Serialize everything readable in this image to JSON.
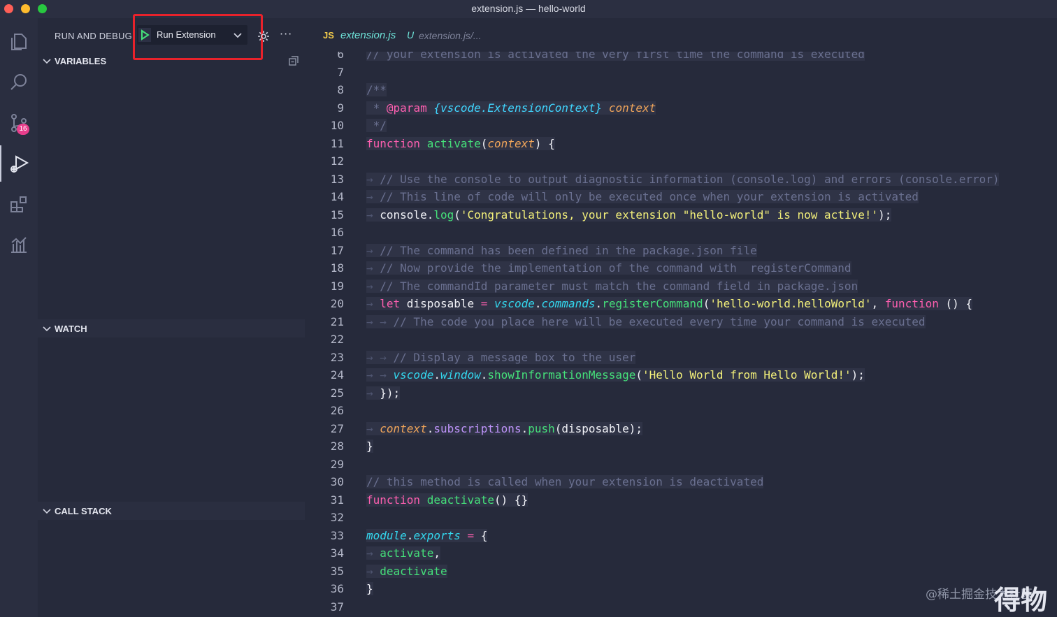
{
  "window": {
    "title": "extension.js — hello-world"
  },
  "activity_bar": {
    "scm_badge": "16"
  },
  "sidebar": {
    "title": "RUN AND DEBUG",
    "run_config": "Run Extension",
    "sections": {
      "variables": "VARIABLES",
      "watch": "WATCH",
      "call_stack": "CALL STACK"
    }
  },
  "editor": {
    "tab": {
      "badge": "JS",
      "filename": "extension.js",
      "status": "U",
      "path": "extension.js/..."
    },
    "lines": [
      {
        "n": "6",
        "tokens": [
          [
            "cm",
            "// your extension is activated the very first time the command is executed"
          ]
        ]
      },
      {
        "n": "7",
        "tokens": []
      },
      {
        "n": "8",
        "tokens": [
          [
            "cm",
            "/**"
          ]
        ]
      },
      {
        "n": "9",
        "tokens": [
          [
            "cm",
            " * "
          ],
          [
            "tg",
            "@param"
          ],
          [
            "tx",
            " "
          ],
          [
            "ty",
            "{vscode.ExtensionContext}"
          ],
          [
            "tx",
            " "
          ],
          [
            "pa",
            "context"
          ]
        ]
      },
      {
        "n": "10",
        "tokens": [
          [
            "cm",
            " */"
          ]
        ]
      },
      {
        "n": "11",
        "tokens": [
          [
            "kw",
            "function"
          ],
          [
            "tx",
            " "
          ],
          [
            "fn",
            "activate"
          ],
          [
            "tx",
            "("
          ],
          [
            "pa",
            "context"
          ],
          [
            "tx",
            ") {"
          ]
        ]
      },
      {
        "n": "12",
        "tokens": []
      },
      {
        "n": "13",
        "tokens": [
          [
            "dim",
            "→ "
          ],
          [
            "cm",
            "// Use the console to output diagnostic information (console.log) and errors (console.error)"
          ]
        ]
      },
      {
        "n": "14",
        "tokens": [
          [
            "dim",
            "→ "
          ],
          [
            "cm",
            "// This line of code will only be executed once when your extension is activated"
          ]
        ]
      },
      {
        "n": "15",
        "tokens": [
          [
            "dim",
            "→ "
          ],
          [
            "tx",
            "console."
          ],
          [
            "fn",
            "log"
          ],
          [
            "tx",
            "("
          ],
          [
            "st",
            "'Congratulations, your extension \"hello-world\" is now active!'"
          ],
          [
            "tx",
            ");"
          ]
        ]
      },
      {
        "n": "16",
        "tokens": []
      },
      {
        "n": "17",
        "tokens": [
          [
            "dim",
            "→ "
          ],
          [
            "cm",
            "// The command has been defined in the package.json file"
          ]
        ]
      },
      {
        "n": "18",
        "tokens": [
          [
            "dim",
            "→ "
          ],
          [
            "cm",
            "// Now provide the implementation of the command with  registerCommand"
          ]
        ]
      },
      {
        "n": "19",
        "tokens": [
          [
            "dim",
            "→ "
          ],
          [
            "cm",
            "// The commandId parameter must match the command field in package.json"
          ]
        ]
      },
      {
        "n": "20",
        "tokens": [
          [
            "dim",
            "→ "
          ],
          [
            "kw",
            "let"
          ],
          [
            "tx",
            " disposable "
          ],
          [
            "op",
            "="
          ],
          [
            "tx",
            " "
          ],
          [
            "ob",
            "vscode"
          ],
          [
            "tx",
            "."
          ],
          [
            "ob",
            "commands"
          ],
          [
            "tx",
            "."
          ],
          [
            "fn",
            "registerCommand"
          ],
          [
            "tx",
            "("
          ],
          [
            "st",
            "'hello-world.helloWorld'"
          ],
          [
            "tx",
            ", "
          ],
          [
            "kw",
            "function"
          ],
          [
            "tx",
            " () {"
          ]
        ]
      },
      {
        "n": "21",
        "tokens": [
          [
            "dim",
            "→ → "
          ],
          [
            "cm",
            "// The code you place here will be executed every time your command is executed"
          ]
        ]
      },
      {
        "n": "22",
        "tokens": []
      },
      {
        "n": "23",
        "tokens": [
          [
            "dim",
            "→ → "
          ],
          [
            "cm",
            "// Display a message box to the user"
          ]
        ]
      },
      {
        "n": "24",
        "tokens": [
          [
            "dim",
            "→ → "
          ],
          [
            "ob",
            "vscode"
          ],
          [
            "tx",
            "."
          ],
          [
            "ob",
            "window"
          ],
          [
            "tx",
            "."
          ],
          [
            "fn",
            "showInformationMessage"
          ],
          [
            "tx",
            "("
          ],
          [
            "st",
            "'Hello World from Hello World!'"
          ],
          [
            "tx",
            ");"
          ]
        ]
      },
      {
        "n": "25",
        "tokens": [
          [
            "dim",
            "→ "
          ],
          [
            "tx",
            "});"
          ]
        ]
      },
      {
        "n": "26",
        "tokens": []
      },
      {
        "n": "27",
        "tokens": [
          [
            "dim",
            "→ "
          ],
          [
            "pa",
            "context"
          ],
          [
            "tx",
            "."
          ],
          [
            "pr",
            "subscriptions"
          ],
          [
            "tx",
            "."
          ],
          [
            "fn",
            "push"
          ],
          [
            "tx",
            "(disposable);"
          ]
        ]
      },
      {
        "n": "28",
        "tokens": [
          [
            "tx",
            "}"
          ]
        ]
      },
      {
        "n": "29",
        "tokens": []
      },
      {
        "n": "30",
        "tokens": [
          [
            "cm",
            "// this method is called when your extension is deactivated"
          ]
        ]
      },
      {
        "n": "31",
        "tokens": [
          [
            "kw",
            "function"
          ],
          [
            "tx",
            " "
          ],
          [
            "fn",
            "deactivate"
          ],
          [
            "tx",
            "() {}"
          ]
        ]
      },
      {
        "n": "32",
        "tokens": []
      },
      {
        "n": "33",
        "tokens": [
          [
            "ob",
            "module"
          ],
          [
            "tx",
            "."
          ],
          [
            "ob",
            "exports"
          ],
          [
            "tx",
            " "
          ],
          [
            "op",
            "="
          ],
          [
            "tx",
            " {"
          ]
        ]
      },
      {
        "n": "34",
        "tokens": [
          [
            "dim",
            "→ "
          ],
          [
            "fn",
            "activate"
          ],
          [
            "tx",
            ","
          ]
        ]
      },
      {
        "n": "35",
        "tokens": [
          [
            "dim",
            "→ "
          ],
          [
            "fn",
            "deactivate"
          ]
        ]
      },
      {
        "n": "36",
        "tokens": [
          [
            "tx",
            "}"
          ]
        ]
      },
      {
        "n": "37",
        "tokens": []
      }
    ]
  },
  "watermark": {
    "text": "@稀土掘金技术社区",
    "logo": "得物"
  },
  "colors": {
    "background": "#262a3b",
    "highlight_border": "#e8222b",
    "accent": "#45e07a"
  }
}
